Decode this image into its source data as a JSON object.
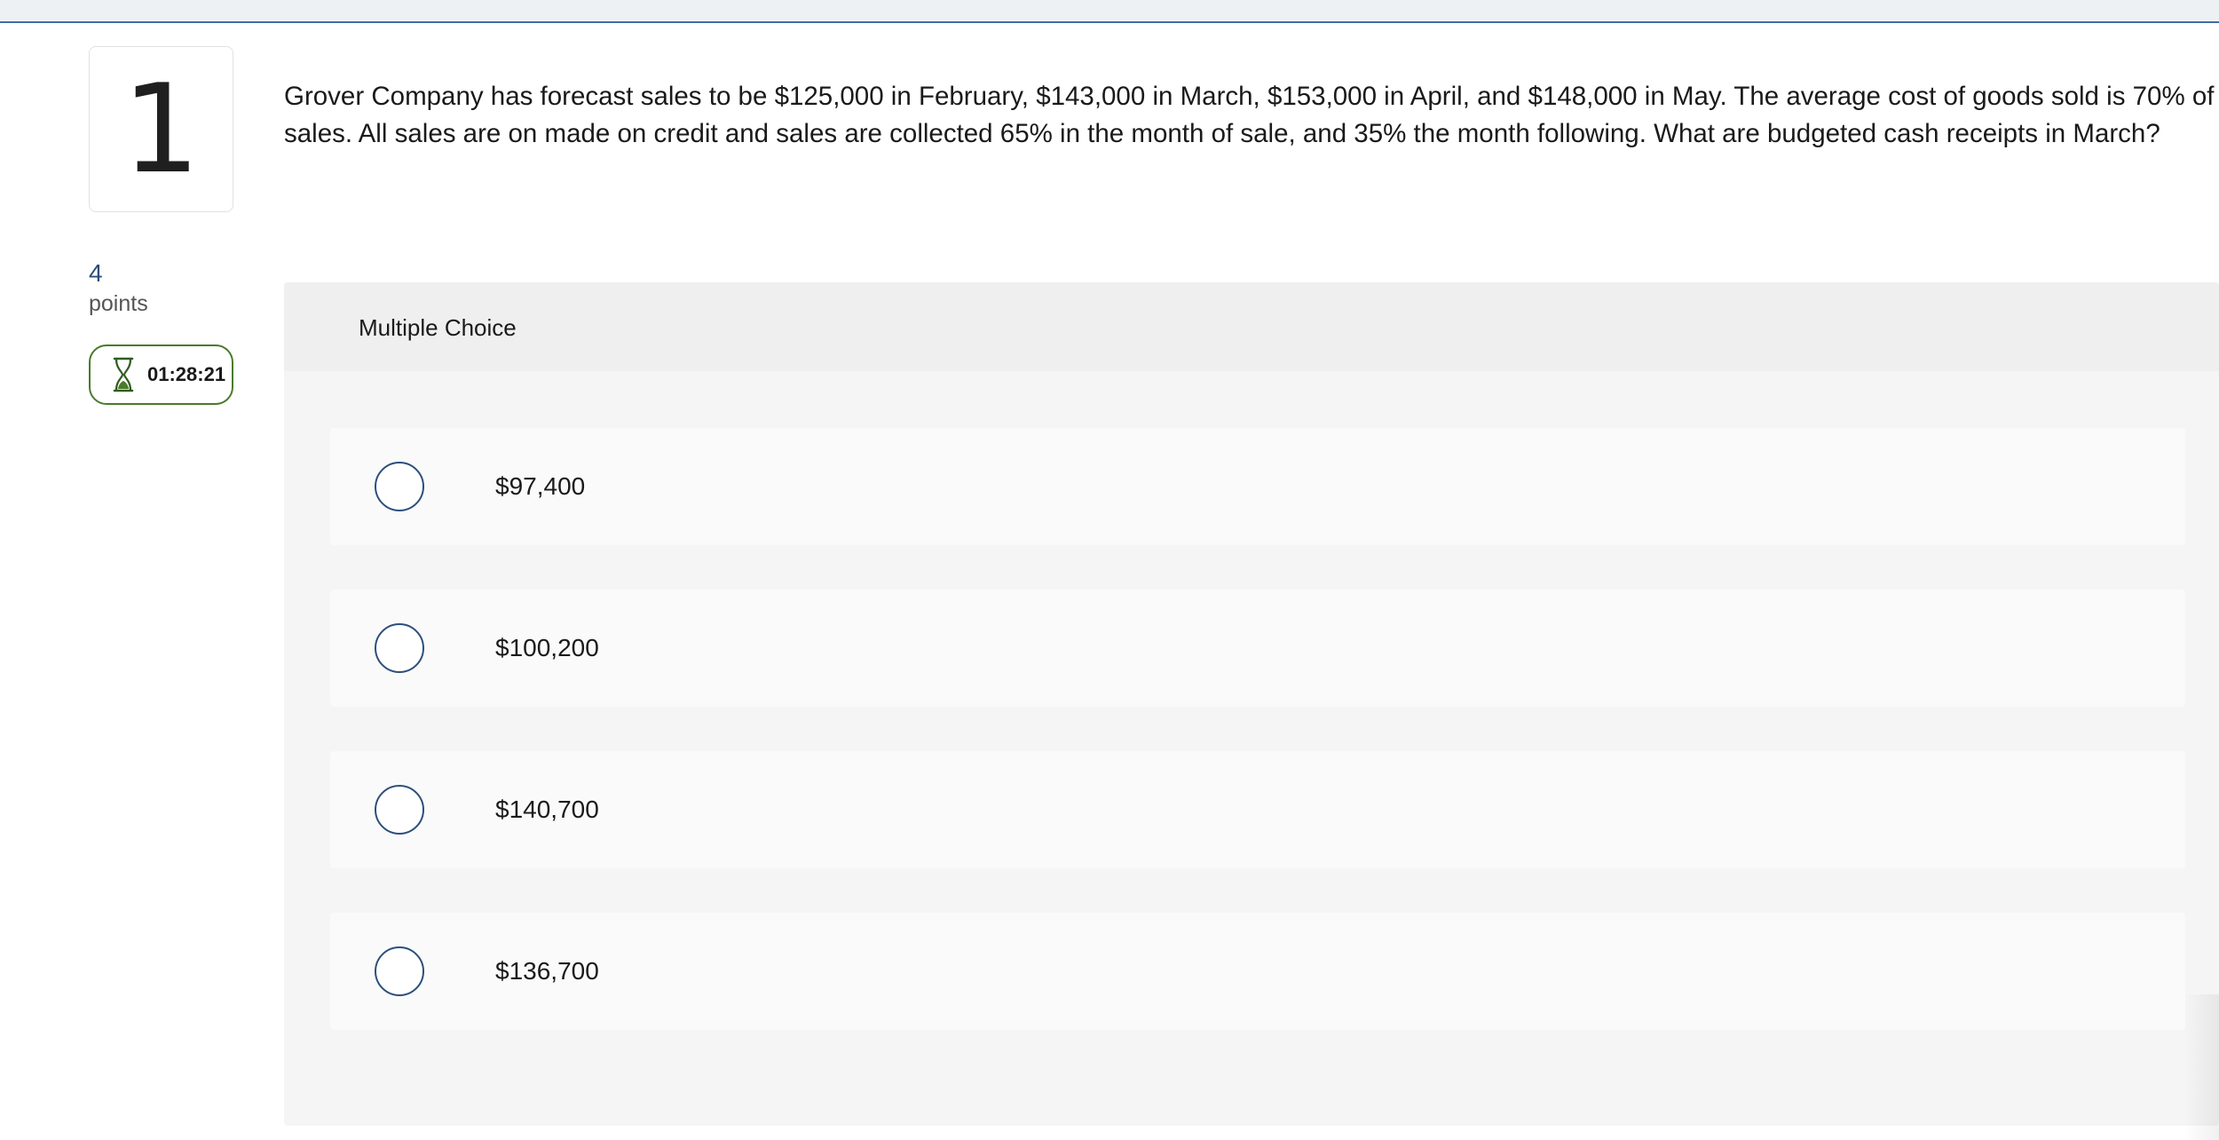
{
  "question": {
    "number": "1",
    "text": "Grover Company has forecast sales to be $125,000 in February, $143,000 in March, $153,000 in April, and $148,000 in May. The average cost of goods sold is 70% of sales. All sales are on made on credit and sales are collected 65% in the month of sale, and 35% the month following. What are budgeted cash receipts in March?",
    "points_value": "4",
    "points_label": "points"
  },
  "timer": {
    "icon": "hourglass-icon",
    "value": "01:28:21",
    "color": "#4a7a2c"
  },
  "multiple_choice": {
    "header": "Multiple Choice",
    "options": [
      {
        "label": "$97,400",
        "selected": false
      },
      {
        "label": "$100,200",
        "selected": false
      },
      {
        "label": "$140,700",
        "selected": false
      },
      {
        "label": "$136,700",
        "selected": false
      }
    ]
  },
  "colors": {
    "accent": "#2c4f7c",
    "top_border": "#3b6ea8"
  }
}
